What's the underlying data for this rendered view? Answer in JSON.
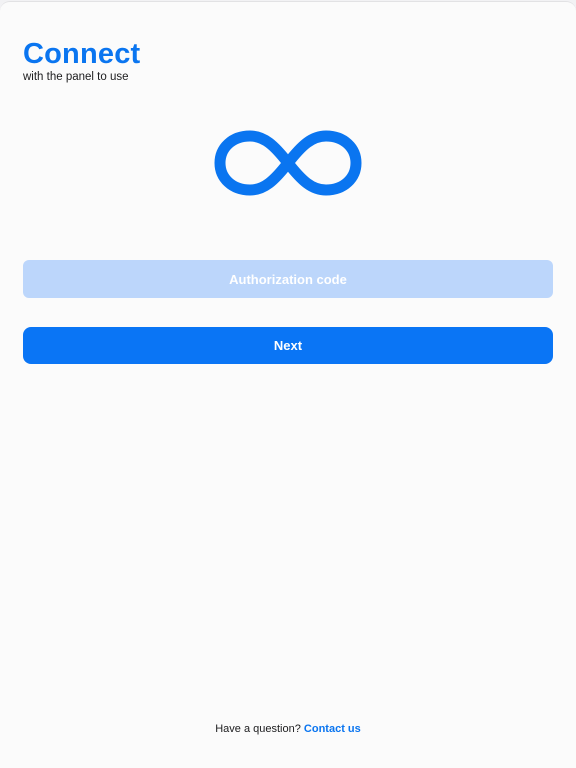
{
  "header": {
    "title": "Connect",
    "subtitle": "with the panel to use"
  },
  "logo": {
    "icon": "infinity-icon",
    "color": "#0a75f0"
  },
  "form": {
    "auth_placeholder": "Authorization code",
    "auth_value": "",
    "next_label": "Next"
  },
  "footer": {
    "question": "Have a question?",
    "contact_label": "Contact us"
  },
  "colors": {
    "accent": "#0a75f5",
    "input_background": "#bcd6fb",
    "background": "#fbfbfb"
  }
}
